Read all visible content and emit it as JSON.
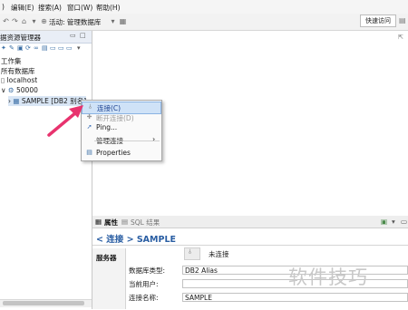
{
  "menubar": {
    "items": [
      ")",
      "编辑(E)",
      "搜索(A)",
      "窗口(W)",
      "帮助(H)"
    ]
  },
  "toolbar": {
    "activity_label": "活动: 管理数据库",
    "quick_access": "快速访问"
  },
  "left_panel": {
    "title": "据资源管理器",
    "tree": [
      {
        "label": "工作集"
      },
      {
        "label": "所有数据库"
      },
      {
        "label": "localhost"
      },
      {
        "label": "50000"
      },
      {
        "label": "SAMPLE [DB2 别名]"
      }
    ]
  },
  "context_menu": {
    "items": [
      {
        "label": "连接(C)",
        "icon": "connect-icon",
        "state": "highlighted"
      },
      {
        "label": "断开连接(D)",
        "icon": "disconnect-icon",
        "state": "disabled"
      },
      {
        "label": "Ping...",
        "icon": "ping-icon",
        "state": "normal"
      },
      {
        "label": "管理连接",
        "icon": "",
        "state": "submenu"
      },
      {
        "label": "Properties",
        "icon": "properties-icon",
        "state": "normal"
      }
    ]
  },
  "bottom_panel": {
    "tabs": [
      "属性",
      "SQL 结果"
    ],
    "breadcrumb": "< 连接 > SAMPLE",
    "side_tab": "服务器",
    "status": "未连接",
    "fields": [
      {
        "label": "数据库类型:",
        "value": "DB2 Alias"
      },
      {
        "label": "当前用户:",
        "value": ""
      },
      {
        "label": "连接名称:",
        "value": "SAMPLE"
      }
    ]
  },
  "watermark": "软件技巧",
  "colors": {
    "accent": "#2a5ea3",
    "highlight": "#cfe2f7",
    "arrow": "#e8336e"
  }
}
